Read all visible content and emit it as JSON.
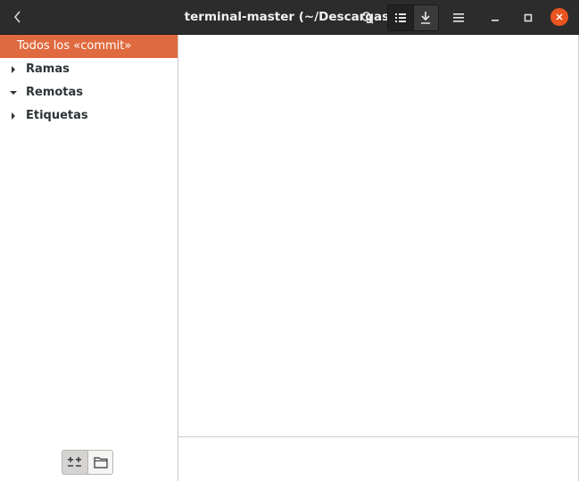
{
  "window": {
    "title": "terminal-master (~/Descargas)",
    "accent_color": "#e95420",
    "selected_color": "#e06a3f"
  },
  "headerbar": {
    "icons": [
      "back-icon",
      "search-icon",
      "list-view-icon",
      "download-icon",
      "hamburger-menu-icon",
      "minimize-icon",
      "maximize-icon",
      "close-icon"
    ]
  },
  "sidebar": {
    "items": [
      {
        "label": "Todos los «commit»",
        "selected": true,
        "expander": "none"
      },
      {
        "label": "Ramas",
        "selected": false,
        "expander": "collapsed"
      },
      {
        "label": "Remotas",
        "selected": false,
        "expander": "expanded"
      },
      {
        "label": "Etiquetas",
        "selected": false,
        "expander": "collapsed"
      }
    ],
    "bottom_buttons": [
      "diff-toggle-icon",
      "folder-icon"
    ]
  }
}
